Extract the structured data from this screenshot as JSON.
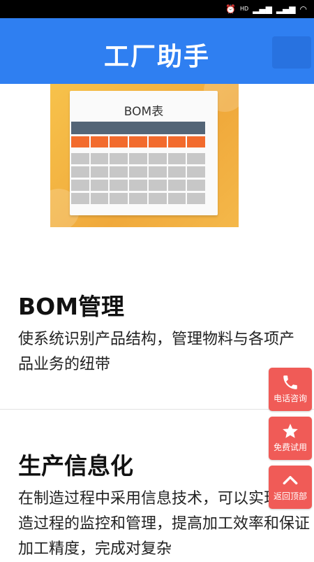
{
  "status_bar": {
    "signal_text": "HD"
  },
  "header": {
    "title": "工厂助手"
  },
  "hero": {
    "title": "BOM表",
    "colors": {
      "dark": "#546577",
      "orange": "#f26b2d",
      "gray": "#c7c7c7"
    }
  },
  "sections": [
    {
      "heading": "BOM管理",
      "body": "使系统识别产品结构，管理物料与各项产品业务的纽带"
    },
    {
      "heading": "生产信息化",
      "body": "在制造过程中采用信息技术，可以实现对制造过程的监控和管理，提高加工效率和保证加工精度，完成对复杂"
    }
  ],
  "floating_actions": [
    {
      "label": "电话咨询",
      "icon": "phone-icon"
    },
    {
      "label": "免费试用",
      "icon": "star-icon"
    },
    {
      "label": "返回顶部",
      "icon": "chevron-up-icon"
    }
  ],
  "colors": {
    "header": "#2f7ff1",
    "fab": "#f05b57"
  }
}
